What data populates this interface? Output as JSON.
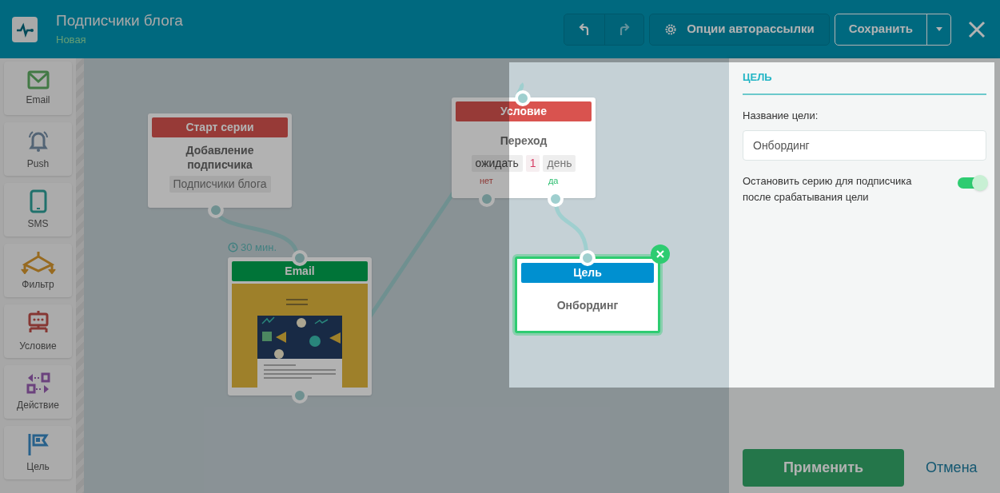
{
  "header": {
    "title": "Подписчики блога",
    "status": "Новая",
    "options_button": "Опции авторассылки",
    "save_button": "Сохранить"
  },
  "palette": [
    {
      "kind": "email",
      "label": "Email"
    },
    {
      "kind": "push",
      "label": "Push"
    },
    {
      "kind": "sms",
      "label": "SMS"
    },
    {
      "kind": "filter",
      "label": "Фильтр"
    },
    {
      "kind": "condition",
      "label": "Условие"
    },
    {
      "kind": "action",
      "label": "Действие"
    },
    {
      "kind": "goal",
      "label": "Цель"
    }
  ],
  "canvas": {
    "start_node": {
      "header": "Старт серии",
      "title": "Добавление подписчика",
      "tag": "Подписчики блога"
    },
    "delay": "30 мин.",
    "email_node": {
      "header": "Email"
    },
    "condition_node": {
      "header": "Условие",
      "title": "Переход",
      "wait": "ожидать",
      "count": "1",
      "unit": "день",
      "no": "нет",
      "yes": "да"
    },
    "goal_node": {
      "header": "Цель",
      "title": "Онбординг",
      "selected": true
    }
  },
  "panel": {
    "section": "ЦЕЛЬ",
    "field_label": "Название цели:",
    "field_value": "Онбординг",
    "toggle": {
      "label": "Остановить серию для подписчика после срабатывания цели",
      "on": true
    },
    "apply_button": "Применить",
    "cancel_link": "Отмена"
  }
}
